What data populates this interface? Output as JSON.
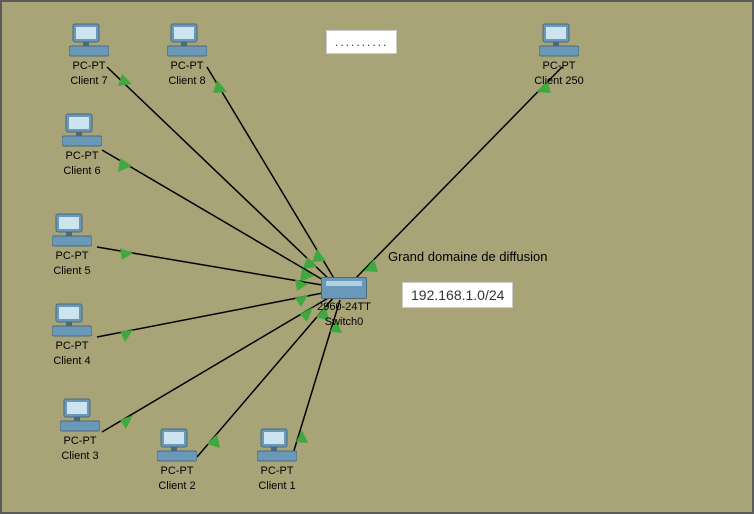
{
  "diagram": {
    "type": "network-topology",
    "tool_hint": "Cisco Packet Tracer"
  },
  "nodes": {
    "pc1": {
      "type_label": "PC-PT",
      "name_label": "Client 1"
    },
    "pc2": {
      "type_label": "PC-PT",
      "name_label": "Client 2"
    },
    "pc3": {
      "type_label": "PC-PT",
      "name_label": "Client 3"
    },
    "pc4": {
      "type_label": "PC-PT",
      "name_label": "Client 4"
    },
    "pc5": {
      "type_label": "PC-PT",
      "name_label": "Client 5"
    },
    "pc6": {
      "type_label": "PC-PT",
      "name_label": "Client 6"
    },
    "pc7": {
      "type_label": "PC-PT",
      "name_label": "Client 7"
    },
    "pc8": {
      "type_label": "PC-PT",
      "name_label": "Client 8"
    },
    "pc250": {
      "type_label": "PC-PT",
      "name_label": "Client 250"
    },
    "switch0": {
      "type_label": "2960-24TT",
      "name_label": "Switch0"
    }
  },
  "annotations": {
    "ellipsis": "..........",
    "domain_text": "Grand domaine de diffusion",
    "subnet": "192.168.1.0/24"
  },
  "links": [
    {
      "from": "pc1",
      "to": "switch0"
    },
    {
      "from": "pc2",
      "to": "switch0"
    },
    {
      "from": "pc3",
      "to": "switch0"
    },
    {
      "from": "pc4",
      "to": "switch0"
    },
    {
      "from": "pc5",
      "to": "switch0"
    },
    {
      "from": "pc6",
      "to": "switch0"
    },
    {
      "from": "pc7",
      "to": "switch0"
    },
    {
      "from": "pc8",
      "to": "switch0"
    },
    {
      "from": "pc250",
      "to": "switch0"
    }
  ]
}
